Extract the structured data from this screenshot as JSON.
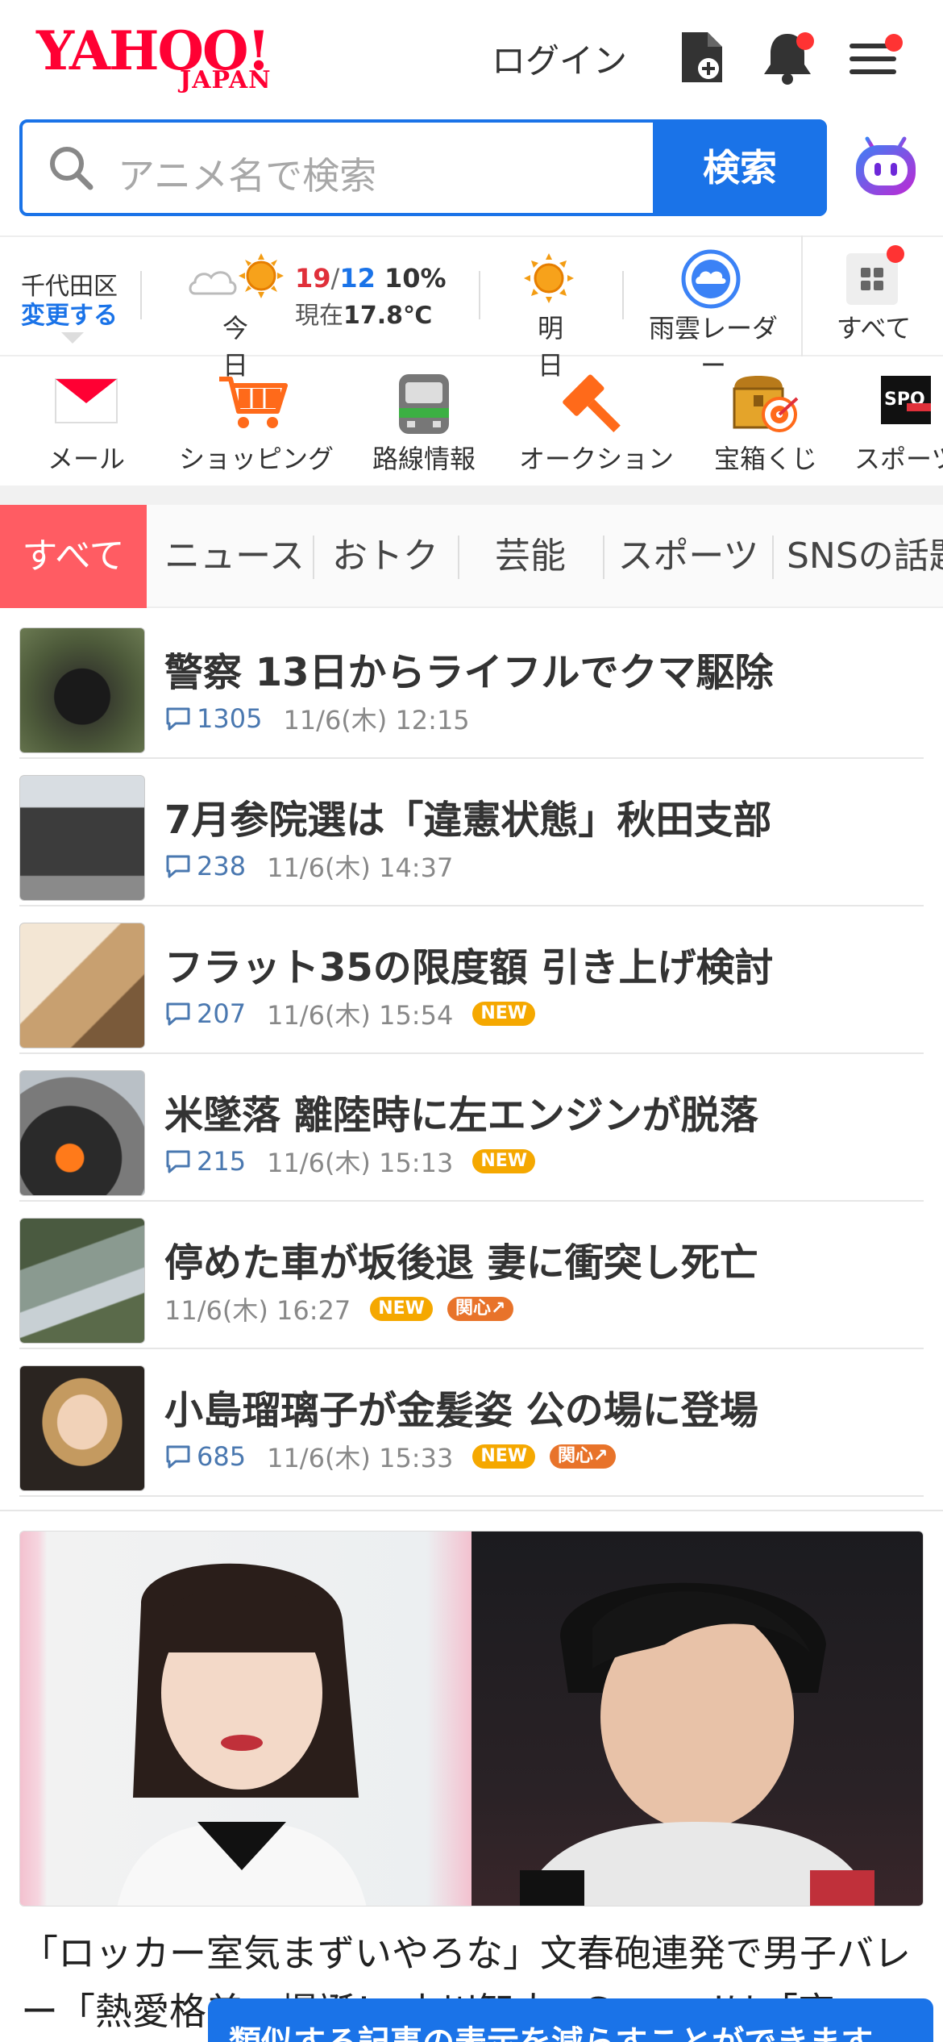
{
  "header": {
    "logo_main": "YAHOO!",
    "logo_sub": "JAPAN",
    "login_label": "ログイン"
  },
  "search": {
    "placeholder": "アニメ名で検索",
    "button_label": "検索"
  },
  "weather": {
    "location": "千代田区",
    "change_label": "変更する",
    "today_label": "今日",
    "temp_high": "19",
    "temp_low": "12",
    "precip": "10%",
    "now_prefix": "現在",
    "now_temp": "17.8℃",
    "tomorrow_label": "明日",
    "radar_label": "雨雲レーダー",
    "all_label": "すべて"
  },
  "services": [
    {
      "label": "メール"
    },
    {
      "label": "ショッピング"
    },
    {
      "label": "路線情報"
    },
    {
      "label": "オークション"
    },
    {
      "label": "宝箱くじ"
    },
    {
      "label": "スポーツ"
    }
  ],
  "tabs": [
    {
      "label": "すべて"
    },
    {
      "label": "ニュース"
    },
    {
      "label": "おトク"
    },
    {
      "label": "芸能"
    },
    {
      "label": "スポーツ"
    },
    {
      "label": "SNSの話題"
    }
  ],
  "news": [
    {
      "title": "警察 13日からライフルでクマ駆除",
      "comments": "1305",
      "time": "11/6(木) 12:15"
    },
    {
      "title": "7月参院選は「違憲状態」秋田支部",
      "comments": "238",
      "time": "11/6(木) 14:37"
    },
    {
      "title": "フラット35の限度額 引き上げ検討",
      "comments": "207",
      "time": "11/6(木) 15:54",
      "badge": "NEW"
    },
    {
      "title": "米墜落 離陸時に左エンジンが脱落",
      "comments": "215",
      "time": "11/6(木) 15:13",
      "badge": "NEW"
    },
    {
      "title": "停めた車が坂後退 妻に衝突し死亡",
      "time": "11/6(木) 16:27",
      "badge": "NEW",
      "badge2": "関心"
    },
    {
      "title": "小島瑠璃子が金髪姿 公の場に登場",
      "comments": "685",
      "time": "11/6(木) 15:33",
      "badge": "NEW",
      "badge2": "関心"
    }
  ],
  "feature": {
    "title": "「ロッカー室気まずいやろな」文春砲連発で男子バレー「熱愛格差」爆誕！ 小川智大×Gacomiは「恋"
  },
  "toast": {
    "text": "類似する記事の表示を減らすことができます"
  },
  "colors": {
    "brand_red": "#ff0033",
    "accent_blue": "#1a73e8",
    "tab_active": "#ff5c63",
    "new_badge": "#f5a800",
    "interest_badge": "#e8732a"
  }
}
